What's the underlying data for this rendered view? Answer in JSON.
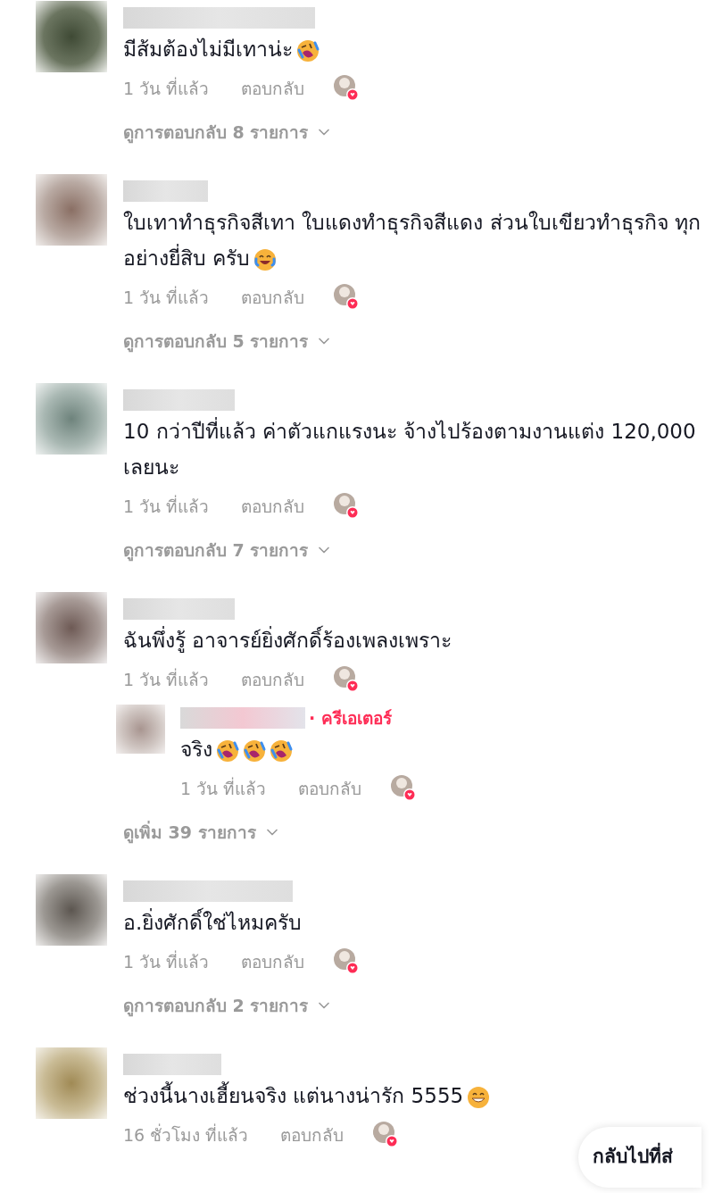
{
  "comments": [
    {
      "text": "มีส้มต้องไม่มีเทาน่ะ",
      "emojis": [
        {
          "kind": "rofl"
        }
      ],
      "time": "1 วัน ที่แล้ว",
      "reply_label": "ตอบกลับ",
      "liked_by_creator": true,
      "replies_link": "ดูการตอบกลับ 8 รายการ"
    },
    {
      "text": "ใบเทาทำธุรกิจสีเทา ใบแดงทำธุรกิจสีแดง ส่วนใบเขียวทำธุรกิจ ทุกอย่างยี่สิบ ครับ",
      "emojis": [
        {
          "kind": "joy"
        }
      ],
      "time": "1 วัน ที่แล้ว",
      "reply_label": "ตอบกลับ",
      "liked_by_creator": true,
      "replies_link": "ดูการตอบกลับ 5 รายการ"
    },
    {
      "text": "10 กว่าปีที่แล้ว ค่าตัวแกแรงนะ จ้างไปร้องตามงานแต่ง 120,000 เลยนะ",
      "time": "1 วัน ที่แล้ว",
      "reply_label": "ตอบกลับ",
      "liked_by_creator": true,
      "replies_link": "ดูการตอบกลับ 7 รายการ"
    },
    {
      "text": "ฉันพึ่งรู้ อาจารย์ยิ่งศักดิ์ร้องเพลงเพราะ",
      "time": "1 วัน ที่แล้ว",
      "reply_label": "ตอบกลับ",
      "liked_by_creator": true,
      "replies": [
        {
          "badge": "· ครีเอเตอร์",
          "text": "จริง",
          "emojis": [
            {
              "kind": "rofl"
            },
            {
              "kind": "rofl"
            },
            {
              "kind": "rofl"
            }
          ],
          "time": "1 วัน ที่แล้ว",
          "reply_label": "ตอบกลับ",
          "liked_by_creator": true
        }
      ],
      "replies_link": "ดูเพิ่ม 39 รายการ"
    },
    {
      "text": "อ.ยิ่งศักดิ์ใช่ไหมครับ",
      "time": "1 วัน ที่แล้ว",
      "reply_label": "ตอบกลับ",
      "liked_by_creator": true,
      "replies_link": "ดูการตอบกลับ 2 รายการ"
    },
    {
      "text": "ช่วงนี้นางเฮี้ยนจริง แต่นางน่ารัก 5555",
      "emojis": [
        {
          "kind": "grin"
        }
      ],
      "time": "16 ชั่วโมง ที่แล้ว",
      "reply_label": "ตอบกลับ",
      "liked_by_creator": true
    }
  ],
  "back_button": {
    "label": "กลับไปที่ส่"
  }
}
